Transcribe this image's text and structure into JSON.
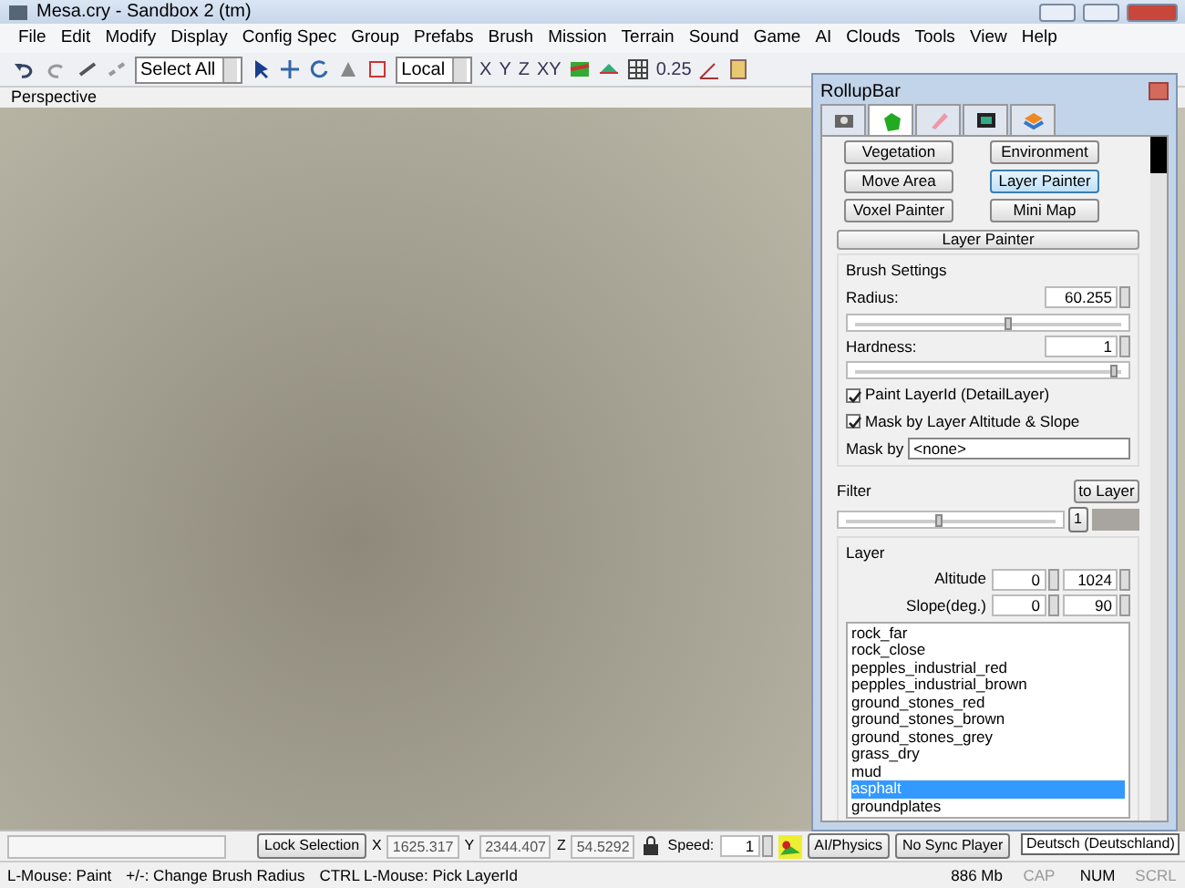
{
  "window": {
    "title": "Mesa.cry - Sandbox 2 (tm)"
  },
  "menu": [
    "File",
    "Edit",
    "Modify",
    "Display",
    "Config Spec",
    "Group",
    "Prefabs",
    "Brush",
    "Mission",
    "Terrain",
    "Sound",
    "Game",
    "AI",
    "Clouds",
    "Tools",
    "View",
    "Help"
  ],
  "toolbar": {
    "selection": "Select All",
    "coordinate_system": "Local",
    "axes": [
      "X",
      "Y",
      "Z",
      "XY"
    ],
    "grid_size": "0.25"
  },
  "viewport": {
    "label": "Perspective"
  },
  "rollup_bar": {
    "title": "RollupBar",
    "tabs": [
      {
        "selected": false
      },
      {
        "selected": true
      },
      {
        "selected": false
      },
      {
        "selected": false
      },
      {
        "selected": false
      }
    ],
    "tool_buttons": [
      {
        "label": "Vegetation",
        "selected": false
      },
      {
        "label": "Environment",
        "selected": false
      },
      {
        "label": "Move Area",
        "selected": false
      },
      {
        "label": "Layer Painter",
        "selected": true
      },
      {
        "label": "Voxel Painter",
        "selected": false
      },
      {
        "label": "Mini Map",
        "selected": false
      }
    ],
    "section_title": "Layer Painter",
    "brush_settings": {
      "title": "Brush Settings",
      "radius": {
        "label": "Radius:",
        "value": "60.255",
        "level": 0.6
      },
      "hardness": {
        "label": "Hardness:",
        "value": "1",
        "level": 1.0
      },
      "checkboxes": [
        {
          "label": "Paint LayerId (DetailLayer)",
          "checked": true
        },
        {
          "label": "Mask by Layer Altitude & Slope",
          "checked": true
        }
      ],
      "mask_by": {
        "label": "Mask by",
        "value": "<none>"
      }
    },
    "filter": {
      "label": "Filter",
      "button": "to Layer",
      "level": 0.47,
      "index": "1"
    },
    "layer": {
      "title": "Layer",
      "altitude": {
        "label": "Altitude",
        "min": "0",
        "max": "1024"
      },
      "slope": {
        "label": "Slope(deg.)",
        "min": "0",
        "max": "90"
      },
      "items": [
        {
          "label": "rock_far",
          "selected": false
        },
        {
          "label": "rock_close",
          "selected": false
        },
        {
          "label": "pepples_industrial_red",
          "selected": false
        },
        {
          "label": "pepples_industrial_brown",
          "selected": false
        },
        {
          "label": "ground_stones_red",
          "selected": false
        },
        {
          "label": "ground_stones_brown",
          "selected": false
        },
        {
          "label": "ground_stones_grey",
          "selected": false
        },
        {
          "label": "grass_dry",
          "selected": false
        },
        {
          "label": "mud",
          "selected": false
        },
        {
          "label": "asphalt",
          "selected": true
        },
        {
          "label": "groundplates",
          "selected": false
        }
      ]
    }
  },
  "bottom_bar": {
    "lock_selection": "Lock Selection",
    "x": {
      "label": "X",
      "value": "1625.317"
    },
    "y": {
      "label": "Y",
      "value": "2344.407"
    },
    "z": {
      "label": "Z",
      "value": "54.5292"
    },
    "speed": {
      "label": "Speed:",
      "value": "1"
    },
    "buttons": [
      "AI/Physics",
      "No Sync Player"
    ],
    "tooltip": "Deutsch (Deutschland)"
  },
  "status_bar": {
    "hints": [
      "L-Mouse: Paint",
      "+/-: Change Brush Radius",
      "CTRL L-Mouse: Pick LayerId"
    ],
    "memory": "886 Mb",
    "indicators": [
      {
        "label": "CAP",
        "on": false
      },
      {
        "label": "NUM",
        "on": true
      },
      {
        "label": "SCRL",
        "on": false
      }
    ]
  }
}
